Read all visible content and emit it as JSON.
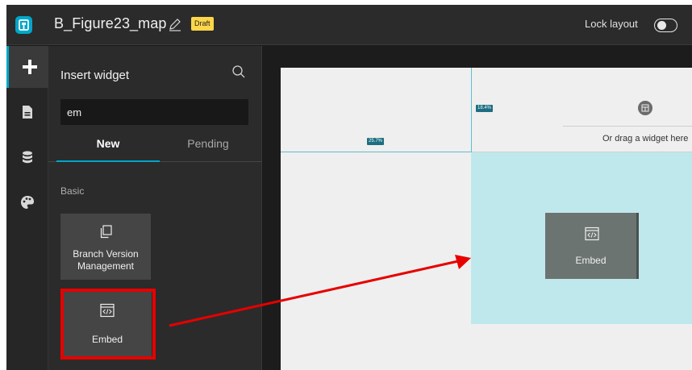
{
  "header": {
    "title": "B_Figure23_map",
    "badge": "Draft",
    "lock_label": "Lock layout",
    "lock_enabled": false
  },
  "rail": {
    "items": [
      {
        "icon": "plus-icon",
        "active": true
      },
      {
        "icon": "page-icon",
        "active": false
      },
      {
        "icon": "database-icon",
        "active": false
      },
      {
        "icon": "palette-icon",
        "active": false
      }
    ]
  },
  "panel": {
    "title": "Insert widget",
    "search_value": "em",
    "tabs": [
      {
        "label": "New",
        "active": true
      },
      {
        "label": "Pending",
        "active": false
      }
    ],
    "section": "Basic",
    "widgets": [
      {
        "label": "Branch Version Management",
        "icon": "branch-version-icon"
      },
      {
        "label": "Embed",
        "icon": "embed-icon"
      }
    ]
  },
  "canvas": {
    "size_tag_left": "25.7%",
    "size_tag_right": "18.4%",
    "placeholder_text": "Or drag a widget here",
    "placed_widget_label": "Embed"
  },
  "colors": {
    "accent": "#00a6c8",
    "highlight": "#e60000",
    "drop_zone": "#bfe8ec",
    "draft_badge": "#ffd64a"
  }
}
